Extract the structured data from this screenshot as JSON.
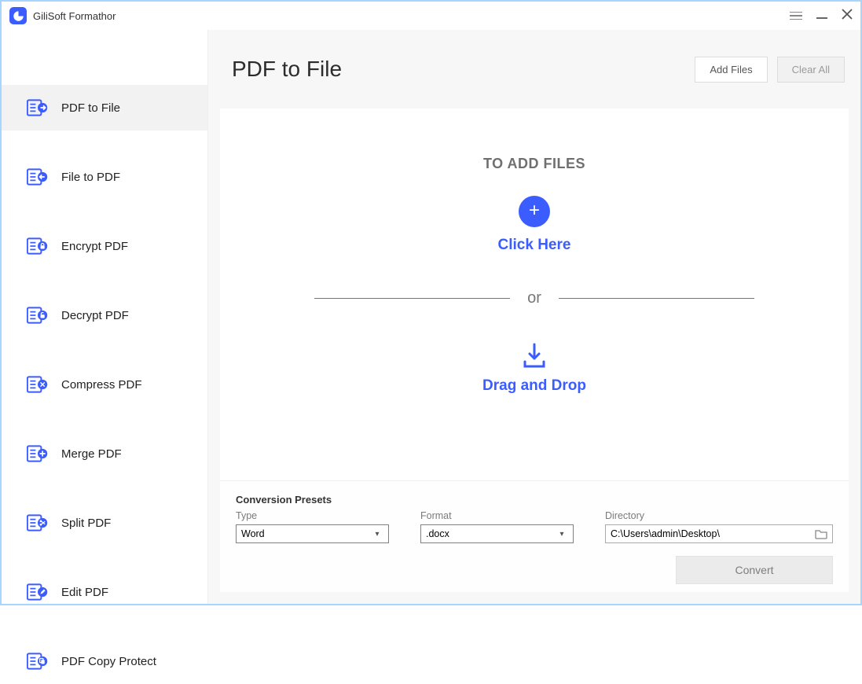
{
  "app": {
    "title": "GiliSoft Formathor"
  },
  "header": {
    "page_title": "PDF to File",
    "add_files": "Add Files",
    "clear_all": "Clear All"
  },
  "sidebar": {
    "items": [
      {
        "label": "PDF to File",
        "icon": "arrow-right"
      },
      {
        "label": "File to PDF",
        "icon": "arrow-left"
      },
      {
        "label": "Encrypt PDF",
        "icon": "lock"
      },
      {
        "label": "Decrypt PDF",
        "icon": "unlock"
      },
      {
        "label": "Compress PDF",
        "icon": "compress"
      },
      {
        "label": "Merge PDF",
        "icon": "plus"
      },
      {
        "label": "Split PDF",
        "icon": "split"
      },
      {
        "label": "Edit PDF",
        "icon": "pencil"
      },
      {
        "label": "PDF Copy Protect",
        "icon": "copy"
      }
    ],
    "active_index": 0
  },
  "dropzone": {
    "heading": "TO ADD FILES",
    "click_here": "Click Here",
    "or": "or",
    "drag_drop": "Drag and Drop"
  },
  "presets": {
    "title": "Conversion Presets",
    "type_label": "Type",
    "type_value": "Word",
    "format_label": "Format",
    "format_value": ".docx",
    "directory_label": "Directory",
    "directory_value": "C:\\Users\\admin\\Desktop\\",
    "convert": "Convert"
  }
}
